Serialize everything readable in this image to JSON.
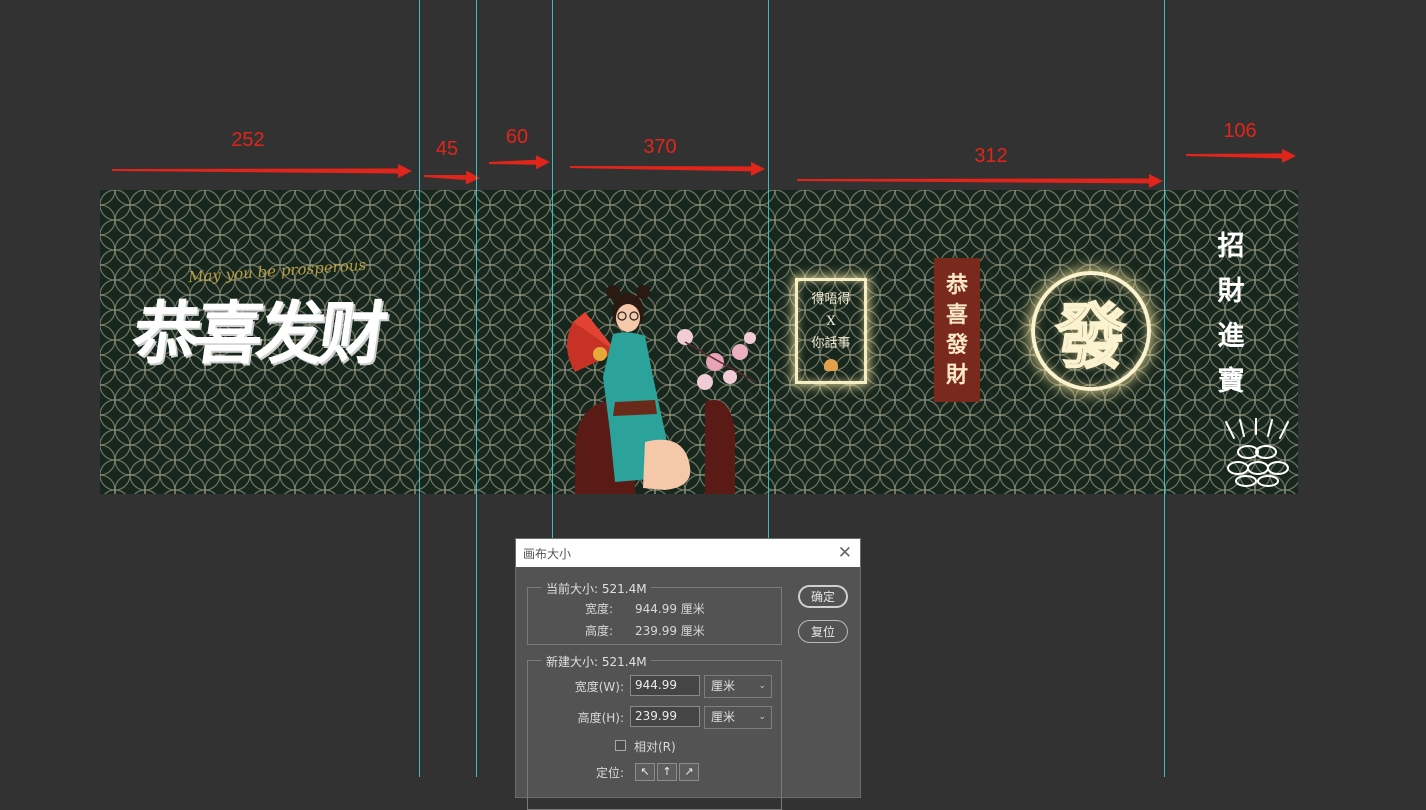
{
  "annotations": {
    "arrows": [
      {
        "label": "252"
      },
      {
        "label": "45"
      },
      {
        "label": "60"
      },
      {
        "label": "370"
      },
      {
        "label": "312"
      },
      {
        "label": "106"
      }
    ],
    "color": "#e1251b"
  },
  "banner": {
    "background": "#17271d",
    "pattern_color": "#b8b49a",
    "title_text": "恭喜发财",
    "script_text": "May you be prosperous",
    "neon_box_lines": [
      "得唔得",
      "X",
      "你話事"
    ],
    "red_banner_chars": [
      "恭",
      "喜",
      "發",
      "財"
    ],
    "fa_char": "發",
    "zhao_chars": [
      "招",
      "財",
      "進",
      "寶"
    ]
  },
  "dialog": {
    "title": "画布大小",
    "close_icon": "close-icon",
    "current": {
      "legend": "当前大小: 521.4M",
      "width_label": "宽度:",
      "width_value": "944.99 厘米",
      "height_label": "高度:",
      "height_value": "239.99 厘米"
    },
    "new": {
      "legend": "新建大小: 521.4M",
      "width_label": "宽度(W):",
      "width_value": "944.99",
      "width_unit": "厘米",
      "height_label": "高度(H):",
      "height_value": "239.99",
      "height_unit": "厘米",
      "relative_label": "相对(R)",
      "anchor_label": "定位:"
    },
    "ok_label": "确定",
    "reset_label": "复位"
  }
}
